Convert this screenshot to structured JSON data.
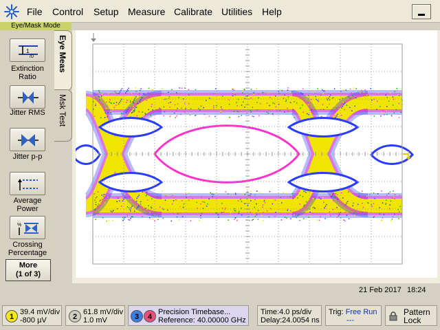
{
  "menu": {
    "items": [
      "File",
      "Control",
      "Setup",
      "Measure",
      "Calibrate",
      "Utilities",
      "Help"
    ]
  },
  "mode_label": "Eye/Mask Mode",
  "tabs": {
    "eye_meas": "Eye Meas",
    "msk_test": "Msk Test"
  },
  "measurements": [
    {
      "label_l1": "Extinction",
      "label_l2": "Ratio",
      "icon": "extinction-ratio-icon"
    },
    {
      "label_l1": "Jitter RMS",
      "label_l2": "",
      "icon": "jitter-rms-icon"
    },
    {
      "label_l1": "Jitter p-p",
      "label_l2": "",
      "icon": "jitter-pp-icon"
    },
    {
      "label_l1": "Average",
      "label_l2": "Power",
      "icon": "average-power-icon"
    },
    {
      "label_l1": "Crossing",
      "label_l2": "Percentage",
      "icon": "crossing-percentage-icon"
    }
  ],
  "more_button": {
    "line1": "More",
    "line2": "(1 of 3)"
  },
  "date": "21 Feb 2017",
  "time": "18:24",
  "channels": [
    {
      "num": "1",
      "line1": "39.4 mV/div",
      "line2": "-800 µV",
      "color": "#f5e620"
    },
    {
      "num": "2",
      "line1": "61.8 mV/div",
      "line2": "1.0 mV",
      "color": "#d0ccc0"
    },
    {
      "num": "3",
      "color": "#3d7fe0"
    },
    {
      "num": "4",
      "color": "#e8507a"
    }
  ],
  "timebase": {
    "line1": "Precision Timebase...",
    "line2": "Reference: 40.00000 GHz"
  },
  "time_info": {
    "line1": "Time:4.0 ps/div",
    "line2": "Delay:24.0054 ns"
  },
  "trigger": {
    "label": "Trig:",
    "value": "Free Run",
    "line2": "---"
  },
  "pattern_lock": {
    "line1": "Pattern",
    "line2": "Lock"
  },
  "colors": {
    "eye_yellow": "#f0e400",
    "eye_magenta": "#ff33cc",
    "eye_blue": "#2a3cff",
    "eye_green": "#00b400",
    "grid": "#999999",
    "mode_bg": "#c8d46a"
  }
}
